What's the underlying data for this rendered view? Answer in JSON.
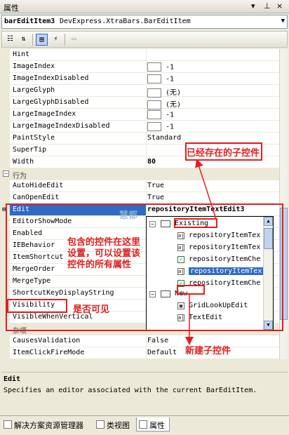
{
  "window": {
    "title": "属性",
    "pin_glyph": "▾",
    "autohide_glyph": "⊥",
    "close_glyph": "×"
  },
  "object_selector": {
    "name": "barEditItem3",
    "type": "DevExpress.XtraBars.BarEditItem"
  },
  "toolbar": {
    "categorized_icon": "categorized-icon",
    "alphabetical_icon": "alphabetical-icon",
    "properties_icon": "properties-icon",
    "events_icon": "events-icon",
    "property_pages_icon": "property-pages-icon"
  },
  "rows": [
    {
      "name": "Hint",
      "value": ""
    },
    {
      "name": "ImageIndex",
      "value": "-1",
      "swatch": true
    },
    {
      "name": "ImageIndexDisabled",
      "value": "-1",
      "swatch": true
    },
    {
      "name": "LargeGlyph",
      "value": "(无)",
      "swatch": true
    },
    {
      "name": "LargeGlyphDisabled",
      "value": "(无)",
      "swatch": true
    },
    {
      "name": "LargeImageIndex",
      "value": "-1",
      "swatch": true
    },
    {
      "name": "LargeImageIndexDisabled",
      "value": "-1",
      "swatch": true
    },
    {
      "name": "PaintStyle",
      "value": "Standard"
    },
    {
      "name": "SuperTip",
      "value": ""
    },
    {
      "name": "Width",
      "value": "80",
      "bold": true
    },
    {
      "name": "行为",
      "value": "",
      "category": true
    },
    {
      "name": "AutoHideEdit",
      "value": "True"
    },
    {
      "name": "CanOpenEdit",
      "value": "True"
    },
    {
      "name": "Edit",
      "value": "repositoryItemTextEdit3",
      "selected": true
    },
    {
      "name": "EditorShowMode",
      "value": ""
    },
    {
      "name": "Enabled",
      "value": ""
    },
    {
      "name": "IEBehavior",
      "value": ""
    },
    {
      "name": "ItemShortcut",
      "value": ""
    },
    {
      "name": "MergeOrder",
      "value": ""
    },
    {
      "name": "MergeType",
      "value": ""
    },
    {
      "name": "ShortcutKeyDisplayString",
      "value": ""
    },
    {
      "name": "Visibility",
      "value": ""
    },
    {
      "name": "VisibleWhenVertical",
      "value": ""
    },
    {
      "name": "杂项",
      "value": "",
      "category": true
    },
    {
      "name": "CausesValidation",
      "value": "False"
    },
    {
      "name": "ItemClickFireMode",
      "value": "Default"
    }
  ],
  "dropdown": {
    "existing_label": "Existing",
    "existing_items": [
      {
        "label": "repositoryItemTex"
      },
      {
        "label": "repositoryItemTex"
      },
      {
        "label": "repositoryItemChe"
      },
      {
        "label": "repositoryItemTex",
        "selected": true
      },
      {
        "label": "repositoryItemChe"
      }
    ],
    "new_label": "New",
    "new_items": [
      {
        "label": "GridLookUpEdit"
      },
      {
        "label": "TextEdit"
      }
    ]
  },
  "annotations": {
    "existing_children": "已经存在的子控件",
    "contained_control": "包含的控件在这里设置，可以设置该控件的所有属性",
    "contained_control_l1": "包含的控件在这里",
    "contained_control_l2": "设置，可以设置该",
    "contained_control_l3": "控件的所有属性",
    "visibility_note": "是否可见",
    "new_child": "新建子控件",
    "watermark": "慧都"
  },
  "description": {
    "title": "Edit",
    "text": "Specifies an editor associated with the current BarEditItem."
  },
  "tabs": [
    {
      "label": "解决方案资源管理器"
    },
    {
      "label": "类视图"
    },
    {
      "label": "属性",
      "active": true
    }
  ]
}
